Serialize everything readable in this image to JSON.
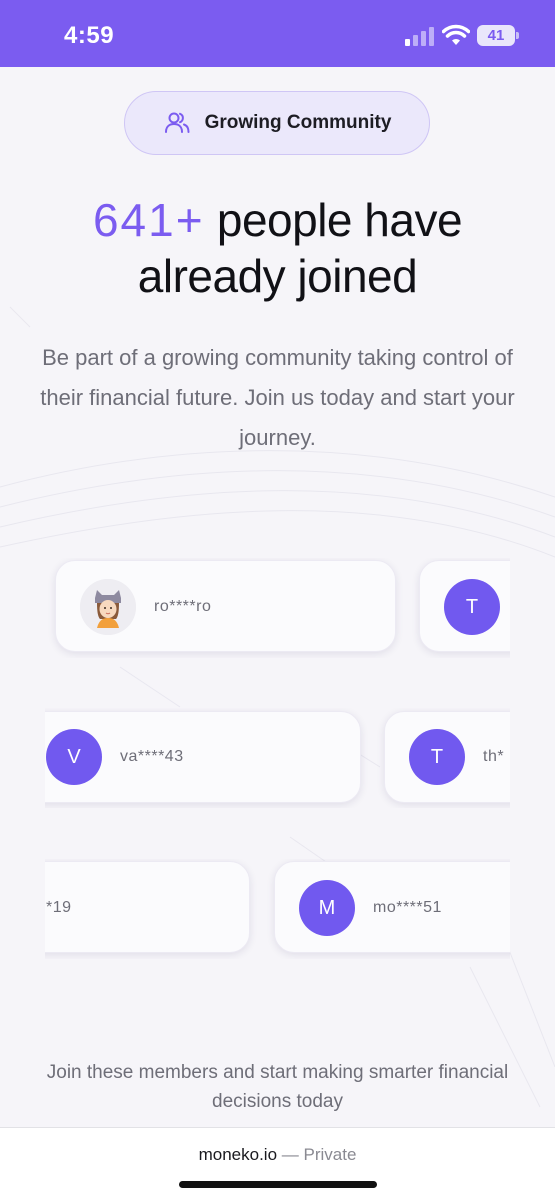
{
  "status_bar": {
    "time": "4:59",
    "battery": "41"
  },
  "badge": {
    "icon": "users-icon",
    "label": "Growing Community"
  },
  "headline": {
    "count": "641+",
    "line1_rest": "people have",
    "line2": "already joined"
  },
  "subtitle": "Be part of a growing community taking control of their financial future. Join us today and start your journey.",
  "members": {
    "row1": [
      {
        "avatar": "",
        "avatar_type": "photo",
        "name": "ro****ro"
      },
      {
        "avatar": "T",
        "avatar_type": "initial",
        "name": ""
      }
    ],
    "row2": [
      {
        "avatar": "V",
        "avatar_type": "initial",
        "name": "va****43"
      },
      {
        "avatar": "T",
        "avatar_type": "initial",
        "name": "th*"
      }
    ],
    "row3": [
      {
        "avatar": "",
        "avatar_type": "none",
        "name": "*19"
      },
      {
        "avatar": "M",
        "avatar_type": "initial",
        "name": "mo****51"
      }
    ]
  },
  "footer_text": "Join these members and start making smarter financial decisions today",
  "browser": {
    "domain": "moneko.io",
    "mode": "— Private"
  },
  "colors": {
    "accent": "#7b5cf0",
    "avatar": "#7159ef",
    "background": "#f6f5f9"
  }
}
